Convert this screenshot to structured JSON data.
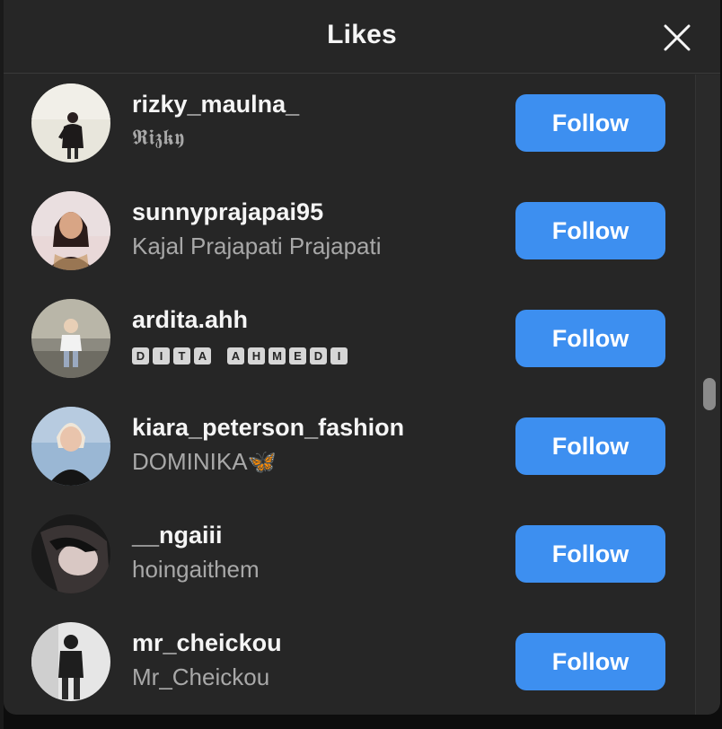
{
  "modal": {
    "title": "Likes",
    "close_icon": "close-x-icon"
  },
  "users": [
    {
      "username": "rizky_maulna_",
      "fullname": "𝕽𝖎𝖟𝖐𝖞",
      "button": "Follow"
    },
    {
      "username": "sunnyprajapai95",
      "fullname": "Kajal Prajapati Prajapati",
      "button": "Follow"
    },
    {
      "username": "ardita.ahh",
      "fullname": "DITA AHMEDI",
      "button": "Follow"
    },
    {
      "username": "kiara_peterson_fashion",
      "fullname": "DOMINIKA🦋",
      "button": "Follow"
    },
    {
      "username": "__ngaiii",
      "fullname": "hoingaithem",
      "button": "Follow"
    },
    {
      "username": "mr_cheickou",
      "fullname": "Mr_Cheickou",
      "button": "Follow"
    }
  ],
  "colors": {
    "background": "#262626",
    "follow_button": "#3d8ff0",
    "primary_text": "#f5f5f5",
    "secondary_text": "#a8a8a8"
  }
}
